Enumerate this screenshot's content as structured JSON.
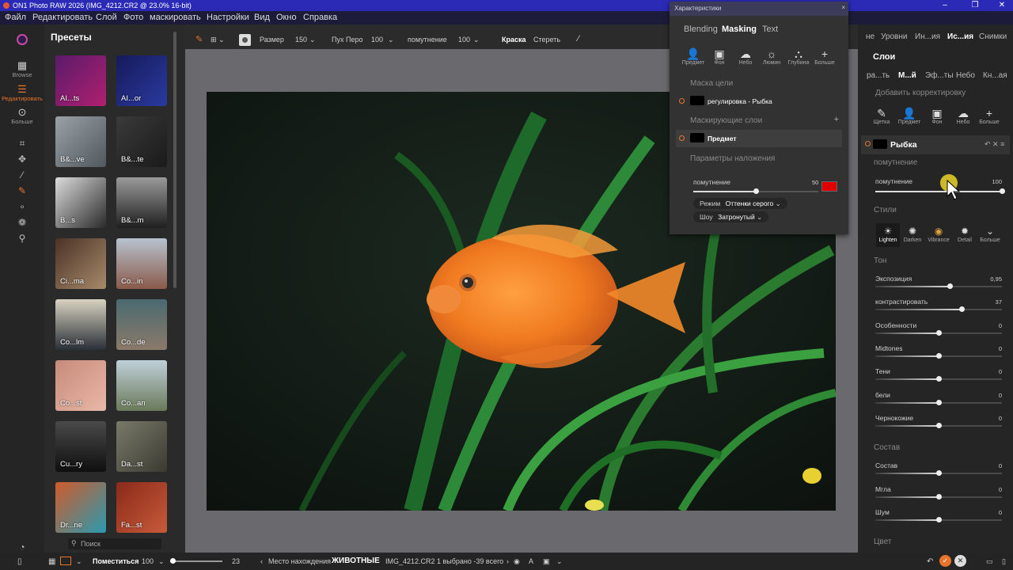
{
  "titlebar": {
    "title": "ON1 Photo RAW 2026 (IMG_4212.CR2 @ 23.0% 16-bit)"
  },
  "menu": [
    "Файл",
    "Редактировать",
    "Слой",
    "Фото",
    "маскировать",
    "Настройки",
    "Вид",
    "Окно",
    "Справка"
  ],
  "rail": {
    "browse": "Browse",
    "edit": "Редактировать",
    "more": "Больше"
  },
  "presets": {
    "title": "Пресеты",
    "items": [
      "AI...ts",
      "AI...or",
      "B&...ve",
      "B&...te",
      "B...s",
      "B&...m",
      "Ci...ma",
      "Co...in",
      "Co...lm",
      "Co...de",
      "Co...st",
      "Co...an",
      "Cu...ry",
      "Da...st",
      "Dr...ne",
      "Fa...st"
    ],
    "search_placeholder": "Поиск"
  },
  "toolbar": {
    "size_label": "Размер",
    "size_value": "150",
    "feather_label": "Пух Перо",
    "feather_value": "100",
    "opacity_label": "помутнение",
    "opacity_value": "100",
    "paint": "Краска",
    "erase": "Стереть"
  },
  "floating": {
    "title": "Характеристики",
    "tabs": [
      "Blending",
      "Masking",
      "Text"
    ],
    "icons": [
      "Предмет",
      "Фон",
      "Небо",
      "Люмин",
      "Глубина",
      "Больше"
    ],
    "mask_target": "Маска цели",
    "target_item": "регулировка - Рыбка",
    "masking_layers": "Маскирующие слои",
    "layer_item": "Предмет",
    "overlay": "Параметры наложения",
    "opacity_label": "помутнение",
    "opacity_value": "50",
    "opacity_level": 0.5,
    "mode_label": "Режим",
    "mode_value": "Оттенки серого",
    "show_label": "Шоу",
    "show_value": "Затронутый",
    "overlay_color": "#e00000"
  },
  "right": {
    "tabs": [
      "не",
      "Уровни",
      "Ин...ия",
      "Ис...ия",
      "Снимки"
    ],
    "section": "Слои",
    "subtabs": [
      "ра...ть",
      "М...й",
      "Эф...ты",
      "Небо",
      "Кн...ая"
    ],
    "add_adjust": "Добавить корректировку",
    "add_icons": [
      "Щетка",
      "Предмет",
      "Фон",
      "Небо",
      "Больше"
    ],
    "layer_name": "Рыбка",
    "opacity_section": "помутнение",
    "opacity_label": "помутнение",
    "opacity_value": "100",
    "styles_section": "Стили",
    "styles": [
      "Lighten",
      "Darken",
      "Vibrance",
      "Detail",
      "Больше"
    ],
    "tone_section": "Тон",
    "tone": [
      {
        "label": "Экспозиция",
        "value": "0,95",
        "level": 0.59
      },
      {
        "label": "контрастировать",
        "value": "37",
        "level": 0.68
      },
      {
        "label": "Особенности",
        "value": "0",
        "level": 0.5
      },
      {
        "label": "Midtones",
        "value": "0",
        "level": 0.5
      },
      {
        "label": "Тени",
        "value": "0",
        "level": 0.5
      },
      {
        "label": "бели",
        "value": "0",
        "level": 0.5
      },
      {
        "label": "Чернокожие",
        "value": "0",
        "level": 0.5
      }
    ],
    "comp_section": "Состав",
    "comp": [
      {
        "label": "Состав",
        "value": "0",
        "level": 0.5
      },
      {
        "label": "Мгла",
        "value": "0",
        "level": 0.5
      },
      {
        "label": "Шум",
        "value": "0",
        "level": 0.5
      }
    ],
    "color_section": "Цвет"
  },
  "bottom": {
    "fit": "Поместиться",
    "zoom": "100",
    "count": "23",
    "location_label": "Место нахождения",
    "location": "ЖИВОТНЫЕ",
    "file": "IMG_4212.CR2",
    "selection": "1 выбрано -39 всего"
  }
}
